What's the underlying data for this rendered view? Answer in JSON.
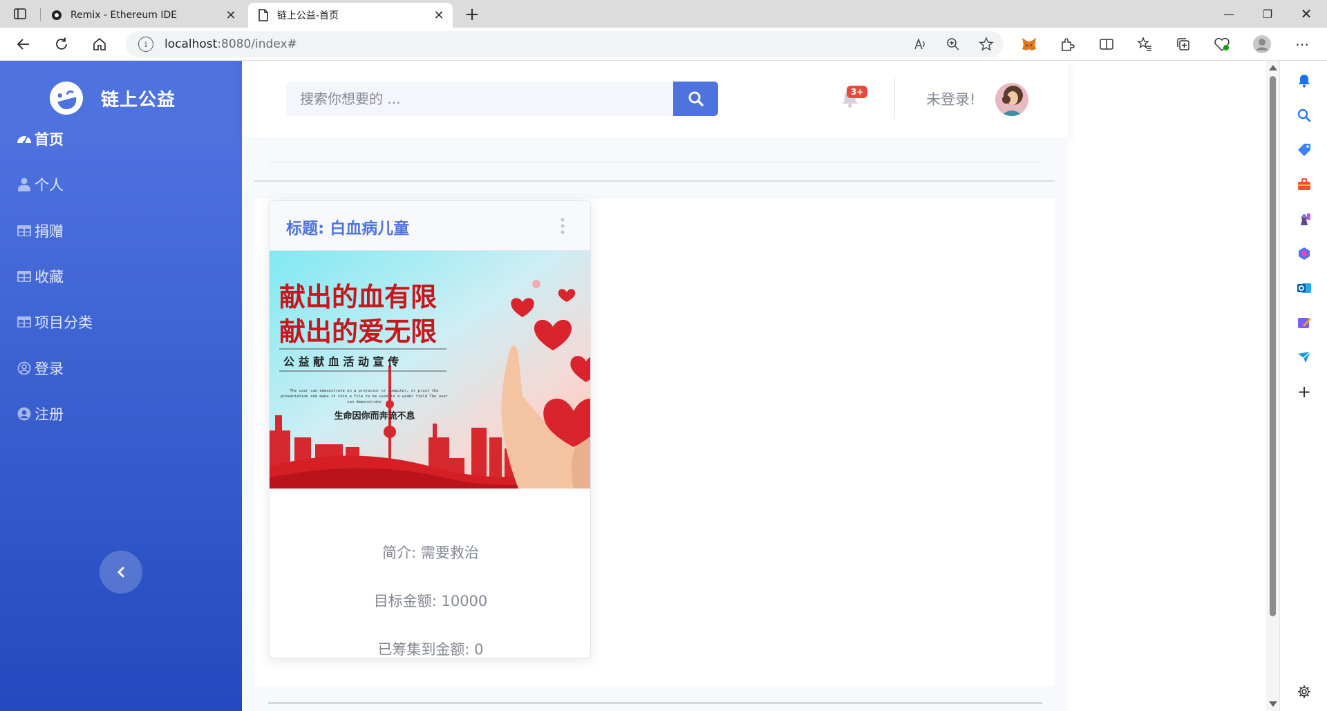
{
  "browser": {
    "tabs": [
      {
        "title": "Remix - Ethereum IDE",
        "active": false
      },
      {
        "title": "链上公益-首页",
        "active": true
      }
    ],
    "address": {
      "host": "localhost",
      "path": ":8080/index#"
    }
  },
  "site": {
    "brand": "链上公益",
    "nav": [
      {
        "label": "首页",
        "icon": "dashboard-icon",
        "active": true
      },
      {
        "label": "个人",
        "icon": "user-icon"
      },
      {
        "label": "捐赠",
        "icon": "table-icon"
      },
      {
        "label": "收藏",
        "icon": "table-icon"
      },
      {
        "label": "项目分类",
        "icon": "table-icon"
      },
      {
        "label": "登录",
        "icon": "user-circle-icon"
      },
      {
        "label": "注册",
        "icon": "user-circle-solid-icon"
      }
    ],
    "search": {
      "placeholder": "搜索你想要的 ..."
    },
    "notifications": {
      "badge": "3+"
    },
    "user": {
      "status": "未登录!"
    }
  },
  "project_card": {
    "title": "标题: 白血病儿童",
    "poster": {
      "headline1": "献出的血有限",
      "headline2": "献出的爱无限",
      "subtitle": "公 益 献 血 活 动 宣 传",
      "small_text1": "The user can demonstrate on a projector or computer, or print the",
      "small_text2": "presentation and make it into a file to be used in a wider field The user",
      "small_text3": "can demonstrate",
      "slogan": "生命因你而奔流不息"
    },
    "intro": "简介: 需要救治",
    "target": "目标金额: 10000",
    "raised": "已筹集到金额: 0"
  },
  "colors": {
    "primary": "#4e73df",
    "sidebar_end": "#224abe",
    "badge": "#e74a3b",
    "muted": "#858796"
  }
}
